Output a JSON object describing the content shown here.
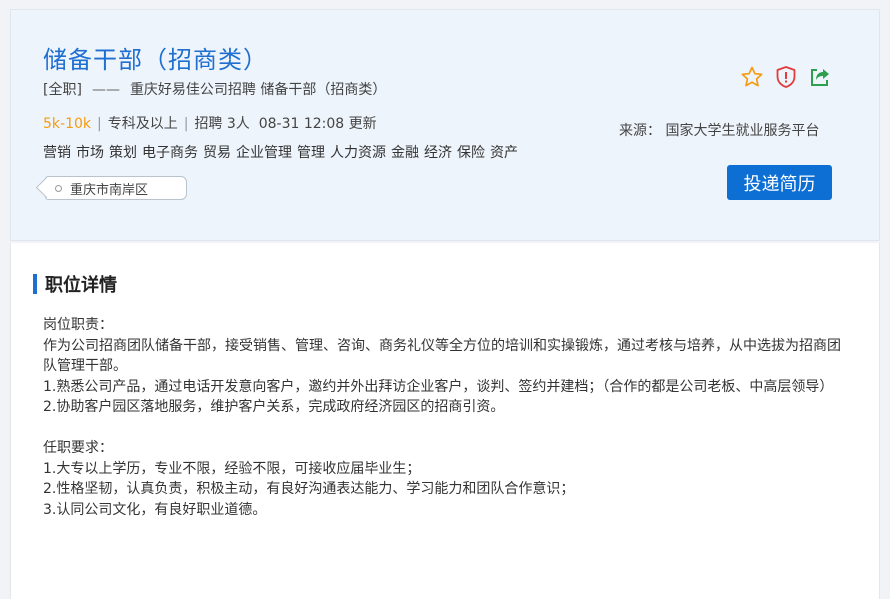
{
  "job": {
    "title": "储备干部（招商类）",
    "type": "[全职]",
    "dash": "——",
    "company_line": "重庆好易佳公司招聘 储备干部（招商类）",
    "salary": "5k-10k",
    "education": "专科及以上",
    "headcount": "招聘 3人",
    "updated": "08-31 12:08 更新",
    "tags": [
      "营销",
      "市场",
      "策划",
      "电子商务",
      "贸易",
      "企业管理",
      "管理",
      "人力资源",
      "金融",
      "经济",
      "保险",
      "资产"
    ],
    "location": "重庆市南岸区",
    "source": "来源： 国家大学生就业服务平台",
    "apply_label": "投递简历"
  },
  "icons": {
    "favorite": "star-outline-icon",
    "report": "shield-alert-icon",
    "share": "share-arrow-icon",
    "colors": {
      "star": "#f39c12",
      "shield": "#e23b3b",
      "share": "#2e9e4f"
    }
  },
  "detail": {
    "heading": "职位详情",
    "lines": [
      "岗位职责：",
      "作为公司招商团队储备干部，接受销售、管理、咨询、商务礼仪等全方位的培训和实操锻炼，通过考核与培养，从中选拔为招商团队管理干部。",
      "1.熟悉公司产品，通过电话开发意向客户，邀约并外出拜访企业客户，谈判、签约并建档；（合作的都是公司老板、中高层领导）",
      "2.协助客户园区落地服务，维护客户关系，完成政府经济园区的招商引资。",
      "",
      "任职要求：",
      "1.大专以上学历，专业不限，经验不限，可接收应届毕业生；",
      "2.性格坚韧，认真负责，积极主动，有良好沟通表达能力、学习能力和团队合作意识；",
      "3.认同公司文化，有良好职业道德。"
    ]
  },
  "colors": {
    "accent": "#1f6fd0",
    "salary": "#f39c12",
    "button": "#0d6fd3"
  }
}
